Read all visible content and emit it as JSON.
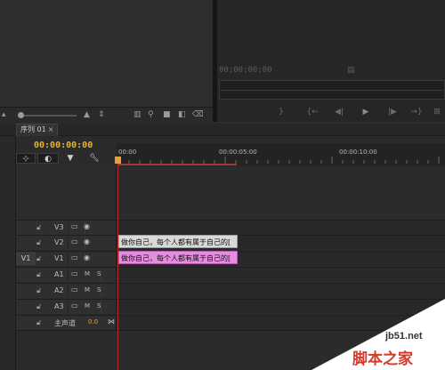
{
  "monitor": {
    "timecode": "00;00;00;00",
    "controls": [
      "}",
      "{←",
      "◀|",
      "▶",
      "|▶",
      "→}",
      "⊞"
    ]
  },
  "project_bar": {
    "icons": [
      "list-view-icon",
      "icon-view-icon",
      "zoom-slider",
      "sort-icon",
      "automate-icon",
      "search-icon",
      "new-bin-icon",
      "new-item-icon",
      "delete-icon"
    ]
  },
  "timeline": {
    "tab_label": "序列 01",
    "tab_close": "×",
    "timecode": "00:00:00:00",
    "ruler": [
      "00:00",
      "00:00:05:00",
      "00:00:10:00"
    ],
    "tools": [
      "snap-icon",
      "link-icon",
      "marker-icon",
      "wrench-icon"
    ],
    "tracks": [
      {
        "name": "V3",
        "type": "video"
      },
      {
        "name": "V2",
        "type": "video"
      },
      {
        "name": "V1",
        "type": "video",
        "target": "V1"
      },
      {
        "name": "A1",
        "type": "audio",
        "m": "M",
        "s": "S"
      },
      {
        "name": "A2",
        "type": "audio",
        "m": "M",
        "s": "S"
      },
      {
        "name": "A3",
        "type": "audio",
        "m": "M",
        "s": "S"
      },
      {
        "name": "主声道",
        "type": "master",
        "value": "0.0"
      }
    ],
    "clips": {
      "v2": "做你自己，每个人都有属于自己的[",
      "v1": "做你自己，每个人都有属于自己的["
    },
    "colors": {
      "timecode": "#e8b32f",
      "playhead": "#b72b2b",
      "clip_v2": "#d9d9d9",
      "clip_v1": "#e58ee0"
    }
  },
  "watermark": {
    "site": "jb51.net",
    "brand": "脚本之家"
  }
}
